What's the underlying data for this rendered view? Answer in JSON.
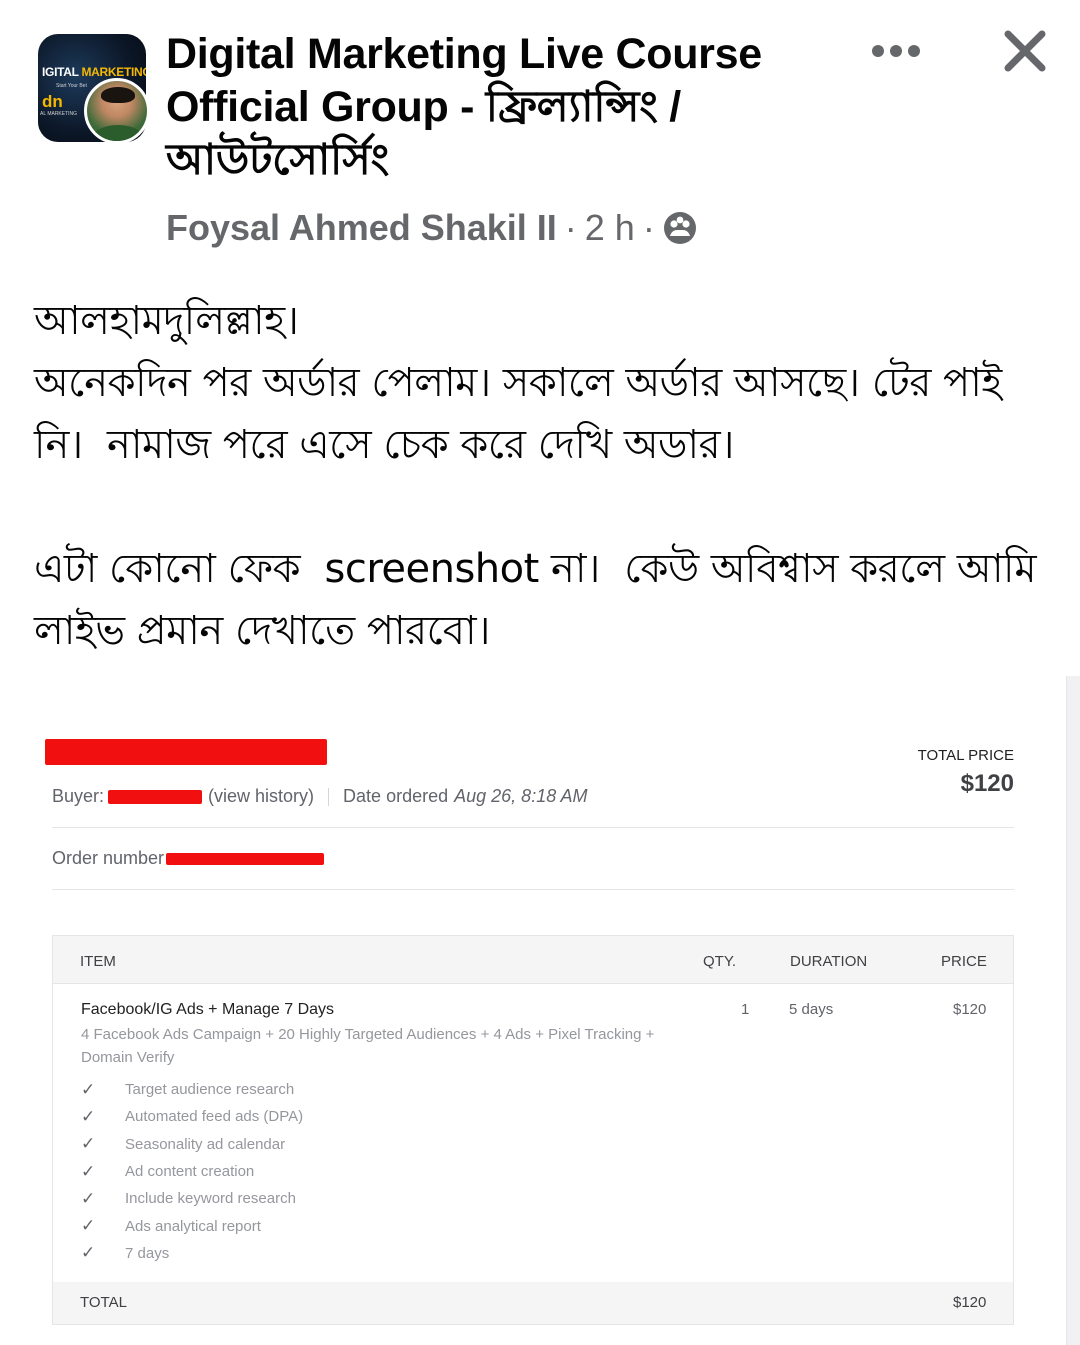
{
  "post": {
    "group_title": "Digital Marketing Live Course Official Group - ফ্রিল্যান্সিং / আউটসোর্সিং",
    "author": "Foysal Ahmed Shakil II",
    "time": "2 h",
    "separator": "·",
    "avatar": {
      "logo_line1_a": "IGITAL",
      "logo_line1_b": "MARKETING",
      "logo_line2": "Start Your Bet",
      "logo_mark": "dn",
      "logo_line3": "AL MARKETING"
    },
    "text": {
      "line1": "আলহামদুলিল্লাহ।",
      "line2": "অনেকদিন পর অর্ডার পেলাম। সকালে অর্ডার আসছে। টের পাই নি।  নামাজ পরে এসে চেক করে দেখি অডার।",
      "line3": "এটা কোনো ফেক  screenshot না।  কেউ অবিশ্বাস করলে আমি লাইভ প্রমান দেখাতে পারবো।"
    },
    "icons": {
      "more": "more-dots-icon",
      "close": "close-icon",
      "privacy": "group-privacy-icon"
    }
  },
  "order": {
    "total_price_label": "TOTAL PRICE",
    "total_price": "$120",
    "buyer_label": "Buyer:",
    "view_history": "(view history)",
    "date_label": "Date ordered",
    "date_value": "Aug 26, 8:18 AM",
    "order_number_label": "Order number",
    "table": {
      "headers": {
        "item": "ITEM",
        "qty": "QTY.",
        "duration": "DURATION",
        "price": "PRICE"
      },
      "row": {
        "title": "Facebook/IG Ads + Manage 7 Days",
        "description": "4 Facebook Ads Campaign + 20 Highly Targeted Audiences + 4 Ads + Pixel Tracking + Domain Verify",
        "qty": "1",
        "duration": "5 days",
        "price": "$120"
      },
      "check_glyph": "✓",
      "features": [
        "Target audience research",
        "Automated feed ads (DPA)",
        "Seasonality ad calendar",
        "Ad content creation",
        "Include keyword research",
        "Ads analytical report",
        "7 days"
      ],
      "total_label": "TOTAL",
      "total_value": "$120"
    },
    "colors": {
      "redaction": "#f20f0f",
      "muted_text": "#95979d"
    }
  }
}
